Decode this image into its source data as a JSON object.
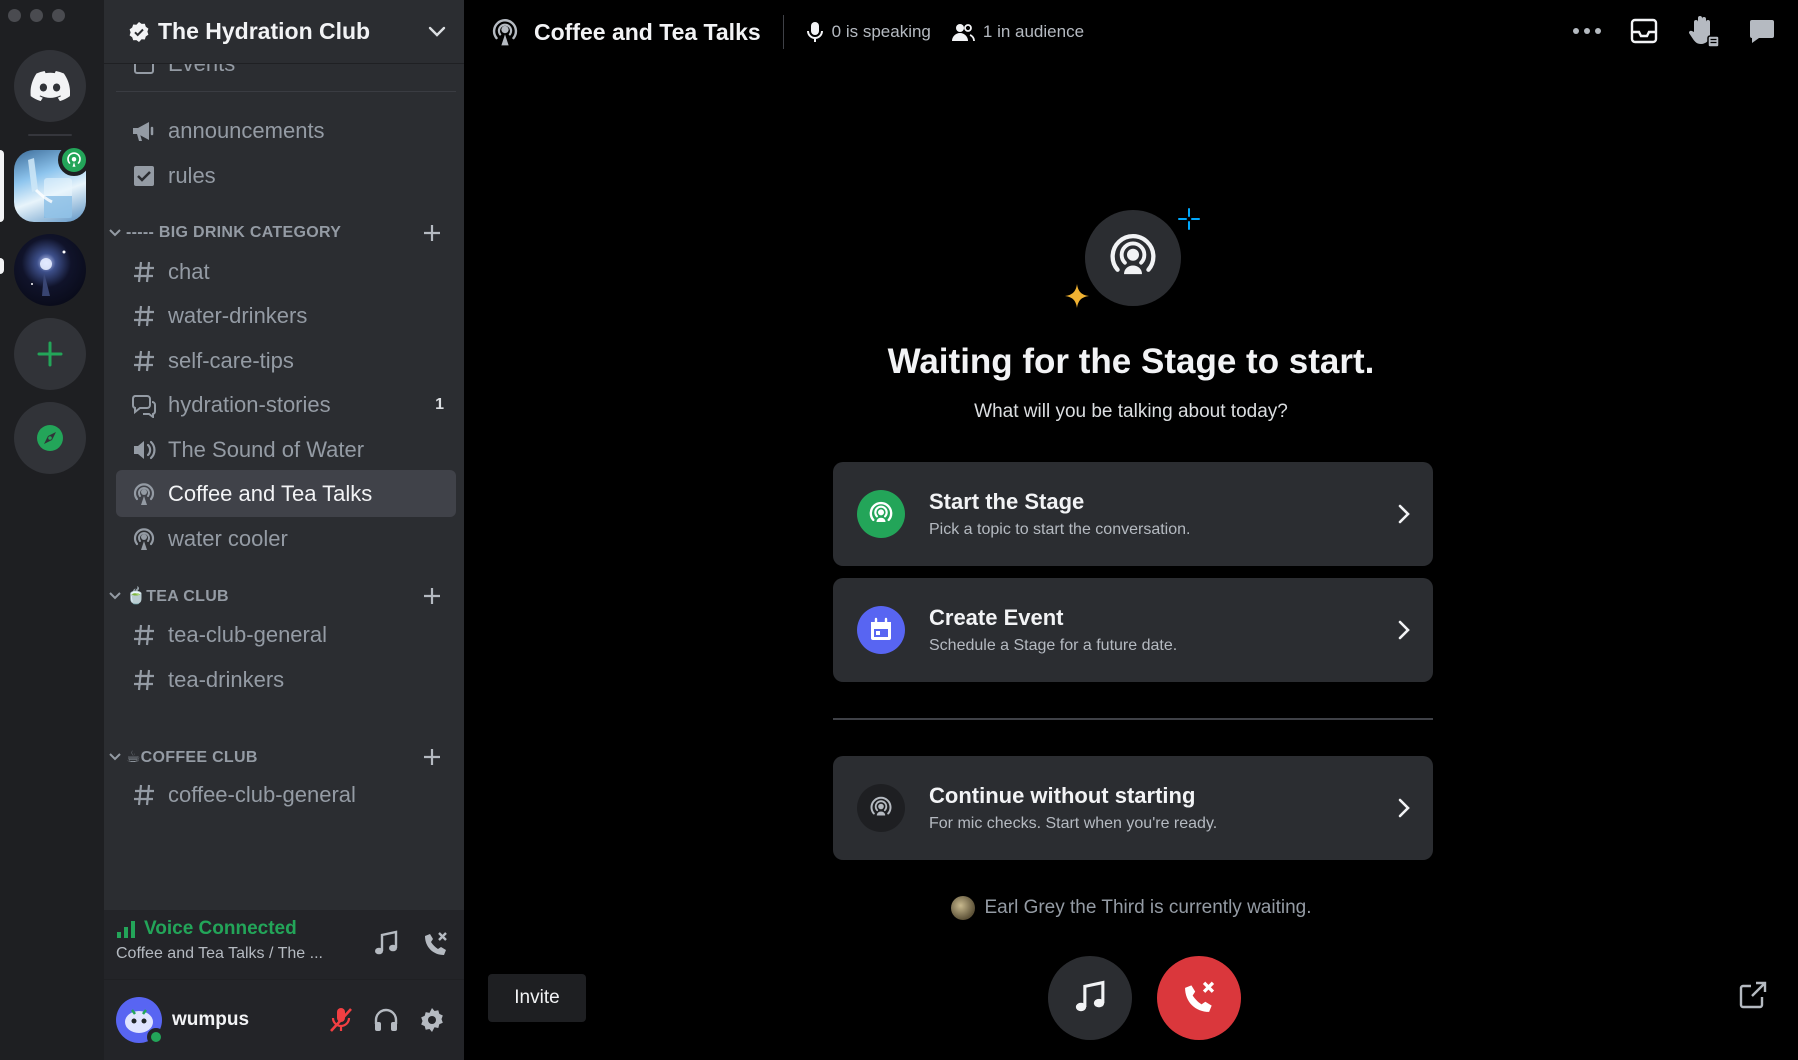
{
  "guild": {
    "name": "The Hydration Club"
  },
  "channels": {
    "partial_top": "Events",
    "items_top": [
      {
        "name": "announcements",
        "icon": "megaphone-icon"
      },
      {
        "name": "rules",
        "icon": "checkbox-icon"
      }
    ],
    "categories": [
      {
        "name": "----- BIG DRINK CATEGORY",
        "items": [
          {
            "name": "chat",
            "icon": "text-channel-icon"
          },
          {
            "name": "water-drinkers",
            "icon": "text-channel-icon"
          },
          {
            "name": "self-care-tips",
            "icon": "text-channel-icon"
          },
          {
            "name": "hydration-stories",
            "icon": "forum-icon",
            "badge": "1"
          },
          {
            "name": "The Sound of Water",
            "icon": "voice-channel-icon"
          },
          {
            "name": "Coffee and Tea Talks",
            "icon": "stage-channel-icon",
            "active": true
          },
          {
            "name": "water cooler",
            "icon": "stage-channel-icon"
          }
        ]
      },
      {
        "name": "🍵TEA CLUB",
        "items": [
          {
            "name": "tea-club-general",
            "icon": "text-channel-icon"
          },
          {
            "name": "tea-drinkers",
            "icon": "text-channel-icon"
          }
        ]
      },
      {
        "name": "☕COFFEE CLUB",
        "items": [
          {
            "name": "coffee-club-general",
            "icon": "text-channel-icon"
          }
        ]
      }
    ]
  },
  "voice": {
    "status": "Voice Connected",
    "location": "Coffee and Tea Talks / The ..."
  },
  "user": {
    "name": "wumpus"
  },
  "topbar": {
    "channel": "Coffee and Tea Talks",
    "speaking": "0 is speaking",
    "audience": "1 in audience"
  },
  "stage": {
    "title": "Waiting for the Stage to start.",
    "subtitle": "What will you be talking about today?",
    "options": [
      {
        "title": "Start the Stage",
        "desc": "Pick a topic to start the conversation.",
        "color": "#23a559"
      },
      {
        "title": "Create Event",
        "desc": "Schedule a Stage for a future date.",
        "color": "#5865f2"
      },
      {
        "title": "Continue without starting",
        "desc": "For mic checks. Start when you're ready.",
        "color": "#1e1f22"
      }
    ],
    "waiting": "Earl Grey the Third is currently waiting."
  },
  "controls": {
    "invite": "Invite"
  },
  "colors": {
    "accent_green": "#23a559",
    "blurple": "#5865f2",
    "danger": "#da373c"
  }
}
